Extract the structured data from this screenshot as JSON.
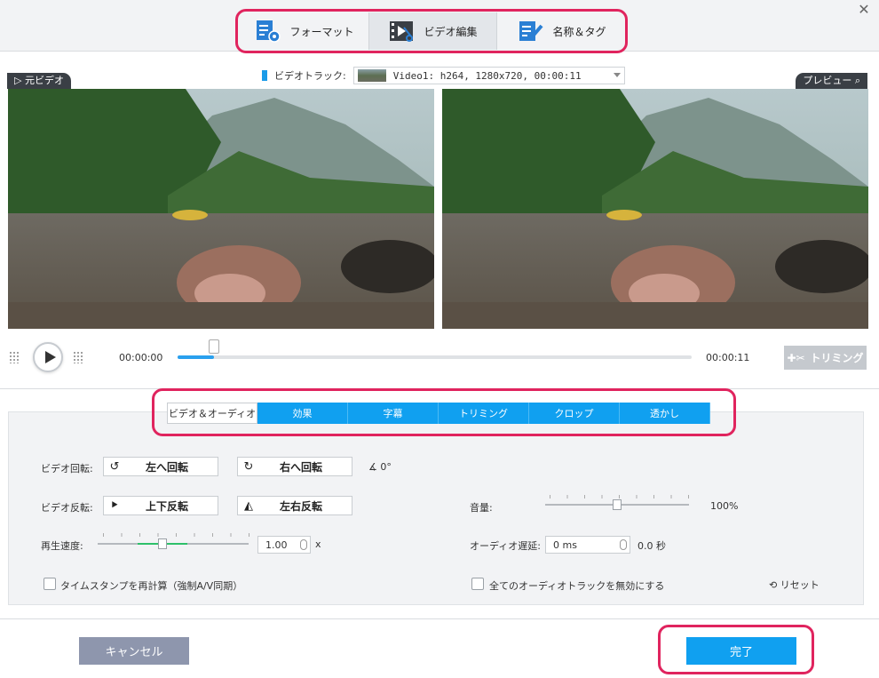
{
  "top_tabs": [
    {
      "label": "フォーマット",
      "icon": "format-settings-icon"
    },
    {
      "label": "ビデオ編集",
      "icon": "video-edit-icon"
    },
    {
      "label": "名称＆タグ",
      "icon": "rename-tag-icon"
    }
  ],
  "track": {
    "label": "ビデオトラック:",
    "value": "Video1: h264, 1280x720, 00:00:11"
  },
  "panels": {
    "source": "元ビデオ",
    "preview": "プレビュー"
  },
  "playback": {
    "current": "00:00:00",
    "total": "00:00:11",
    "progress": 0.07,
    "trim_label": "トリミング"
  },
  "sub_tabs": [
    "ビデオ＆オーディオ",
    "効果",
    "字幕",
    "トリミング",
    "クロップ",
    "透かし"
  ],
  "rotation": {
    "label": "ビデオ回転:",
    "left": "左へ回転",
    "right": "右へ回転",
    "angle": "0°"
  },
  "flip": {
    "label": "ビデオ反転:",
    "vertical": "上下反転",
    "horizontal": "左右反転"
  },
  "volume": {
    "label": "音量:",
    "value": "100%",
    "level": 0.5
  },
  "speed": {
    "label": "再生速度:",
    "value": "1.00",
    "unit": "x",
    "level": 0.43
  },
  "audio_delay": {
    "label": "オーディオ遅延:",
    "value": "0 ms",
    "readout": "0.0 秒"
  },
  "options": {
    "timestamp": "タイムスタンプを再計算（強制A/V同期）",
    "disable_audio": "全てのオーディオトラックを無効にする",
    "reset": "リセット"
  },
  "footer": {
    "cancel": "キャンセル",
    "done": "完了"
  },
  "colors": {
    "accent": "#10a0f0",
    "highlight": "#e0245e",
    "cancel": "#8e96ad"
  }
}
